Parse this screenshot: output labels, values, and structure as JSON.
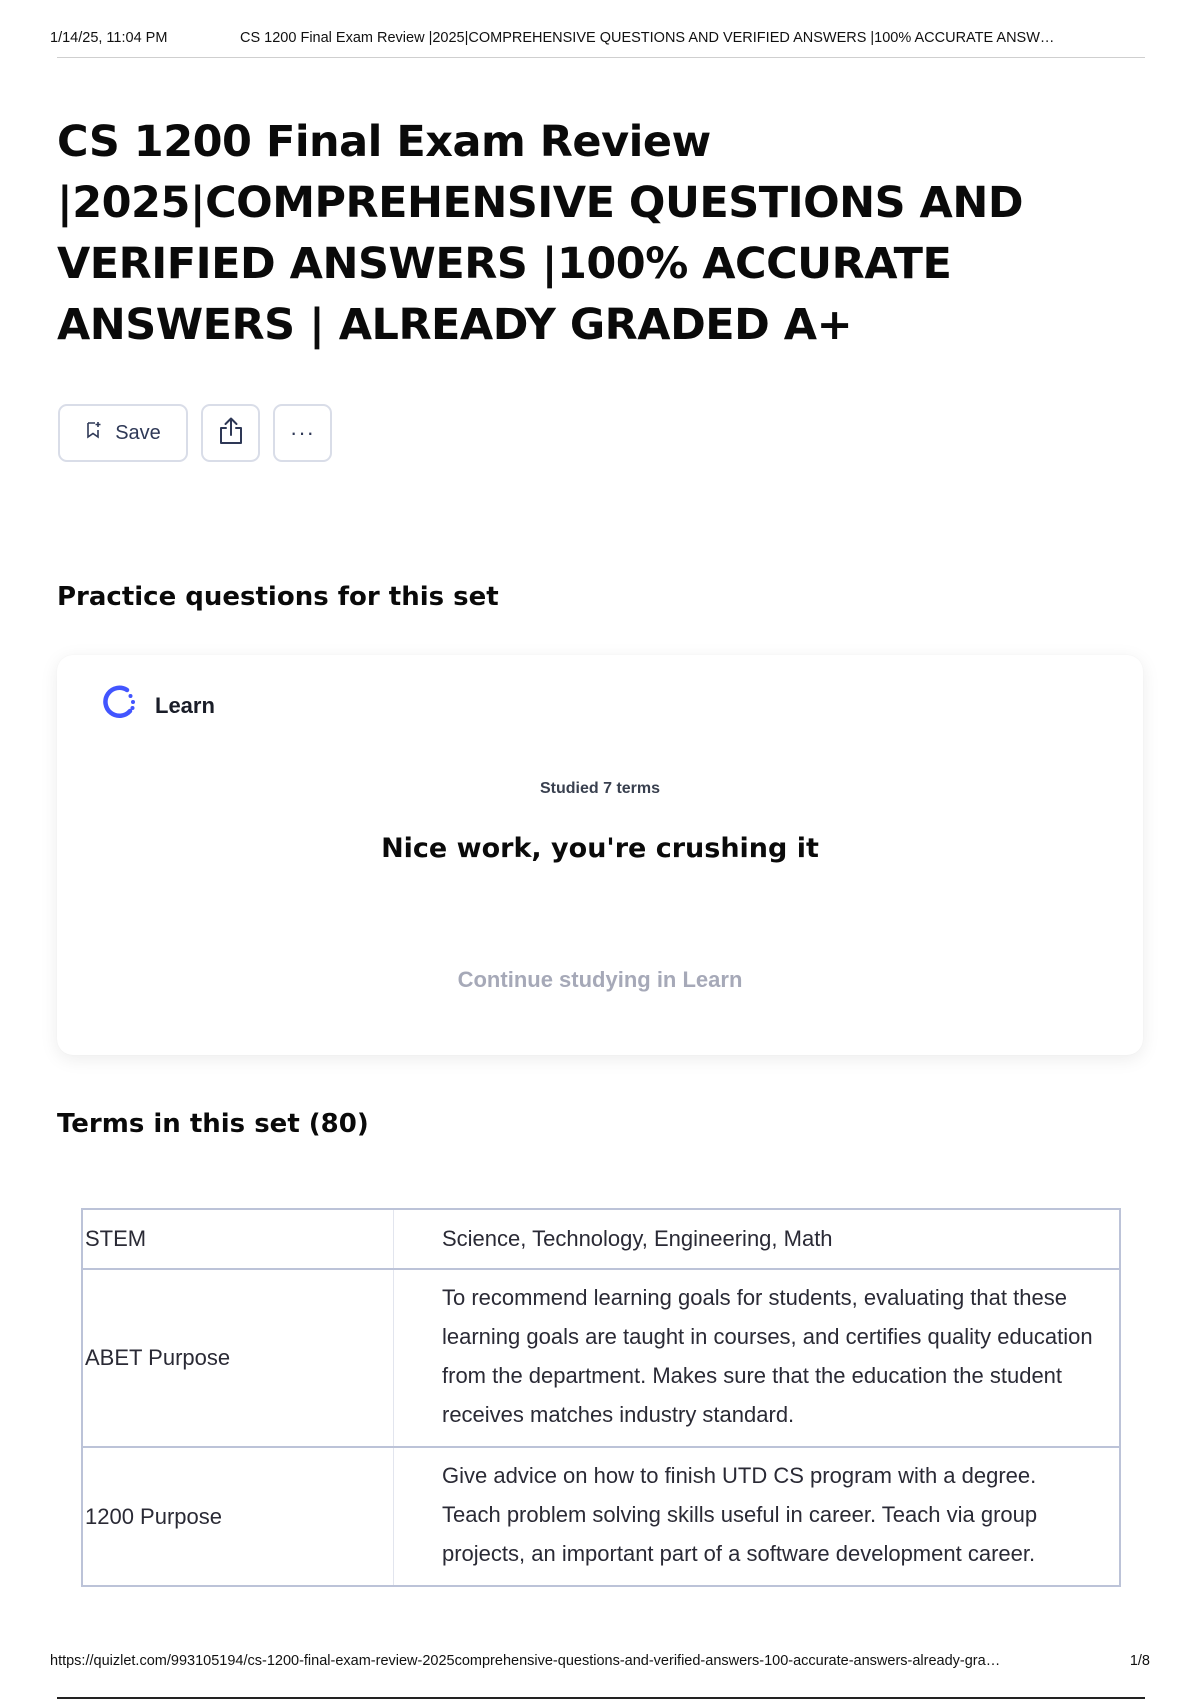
{
  "print_header": {
    "date": "1/14/25, 11:04 PM",
    "doc_title": "CS 1200 Final Exam Review |2025|COMPREHENSIVE QUESTIONS AND VERIFIED ANSWERS |100% ACCURATE ANSW…"
  },
  "page_title": "CS 1200 Final Exam Review |2025|COMPREHENSIVE QUESTIONS AND VERIFIED ANSWERS |100% ACCURATE ANSWERS | ALREADY GRADED A+",
  "actions": {
    "save_label": "Save",
    "share_icon": "share-icon",
    "more_label": "···"
  },
  "practice": {
    "heading": "Practice questions for this set",
    "card": {
      "mode_label": "Learn",
      "studied": "Studied 7 terms",
      "message": "Nice work, you're crushing it",
      "continue_label": "Continue studying in Learn",
      "accent_color": "#4255ff"
    }
  },
  "terms": {
    "heading": "Terms in this set (80)",
    "rows": [
      {
        "term": "STEM",
        "definition": "Science, Technology, Engineering, Math"
      },
      {
        "term": "ABET Purpose",
        "definition": "To recommend learning goals for students, evaluating that these learning goals are taught in courses, and certifies quality education from the department. Makes sure that the education the student receives matches industry standard."
      },
      {
        "term": "1200 Purpose",
        "definition": "Give advice on how to finish UTD CS program with a degree. Teach problem solving skills useful in career. Teach via group projects, an important part of a software development career."
      }
    ]
  },
  "print_footer": {
    "url": "https://quizlet.com/993105194/cs-1200-final-exam-review-2025comprehensive-questions-and-verified-answers-100-accurate-answers-already-gra…",
    "page": "1/8"
  }
}
